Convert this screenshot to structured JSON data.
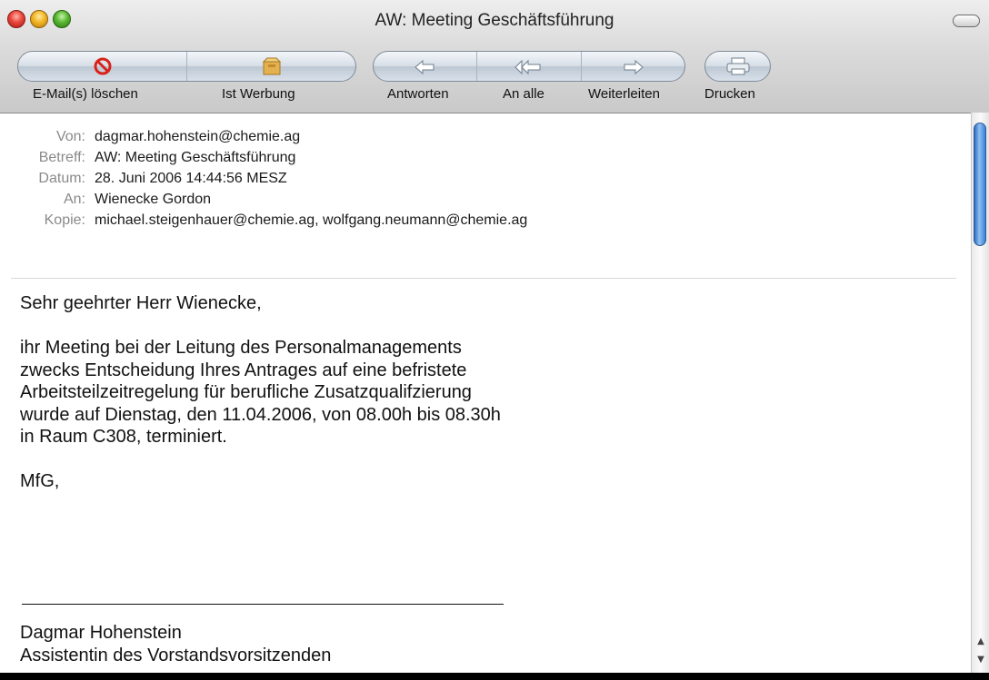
{
  "window": {
    "title": "AW: Meeting Geschäftsführung"
  },
  "toolbar": {
    "delete_label": "E-Mail(s) löschen",
    "junk_label": "Ist Werbung",
    "reply_label": "Antworten",
    "reply_all_label": "An alle",
    "forward_label": "Weiterleiten",
    "print_label": "Drucken"
  },
  "header": {
    "from_label": "Von:",
    "from": "dagmar.hohenstein@chemie.ag",
    "subject_label": "Betreff:",
    "subject": "AW: Meeting Geschäftsführung",
    "date_label": "Datum:",
    "date": "28. Juni 2006 14:44:56 MESZ",
    "to_label": "An:",
    "to": "Wienecke Gordon",
    "cc_label": "Kopie:",
    "cc": "michael.steigenhauer@chemie.ag, wolfgang.neumann@chemie.ag"
  },
  "body": {
    "greeting": "Sehr geehrter Herr Wienecke,",
    "lines": [
      "ihr Meeting bei der Leitung des Personalmanagements",
      "zwecks Entscheidung Ihres Antrages auf eine befristete",
      "Arbeitsteilzeitregelung für berufliche Zusatzqualifzierung",
      "wurde auf Dienstag, den 11.04.2006, von 08.00h bis 08.30h",
      "in Raum C308, terminiert."
    ],
    "closing": "MfG,",
    "signature_name": "Dagmar Hohenstein",
    "signature_title": "Assistentin des Vorstandsvorsitzenden"
  },
  "icons": {
    "delete": "no-entry-icon",
    "junk": "junk-mail-icon",
    "reply": "reply-arrow-icon",
    "reply_all": "reply-all-arrow-icon",
    "forward": "forward-arrow-icon",
    "print": "printer-icon"
  },
  "colors": {
    "delete_red": "#d8231a",
    "junk_gold": "#d9a03a",
    "scroll_blue": "#3c7fd4"
  }
}
